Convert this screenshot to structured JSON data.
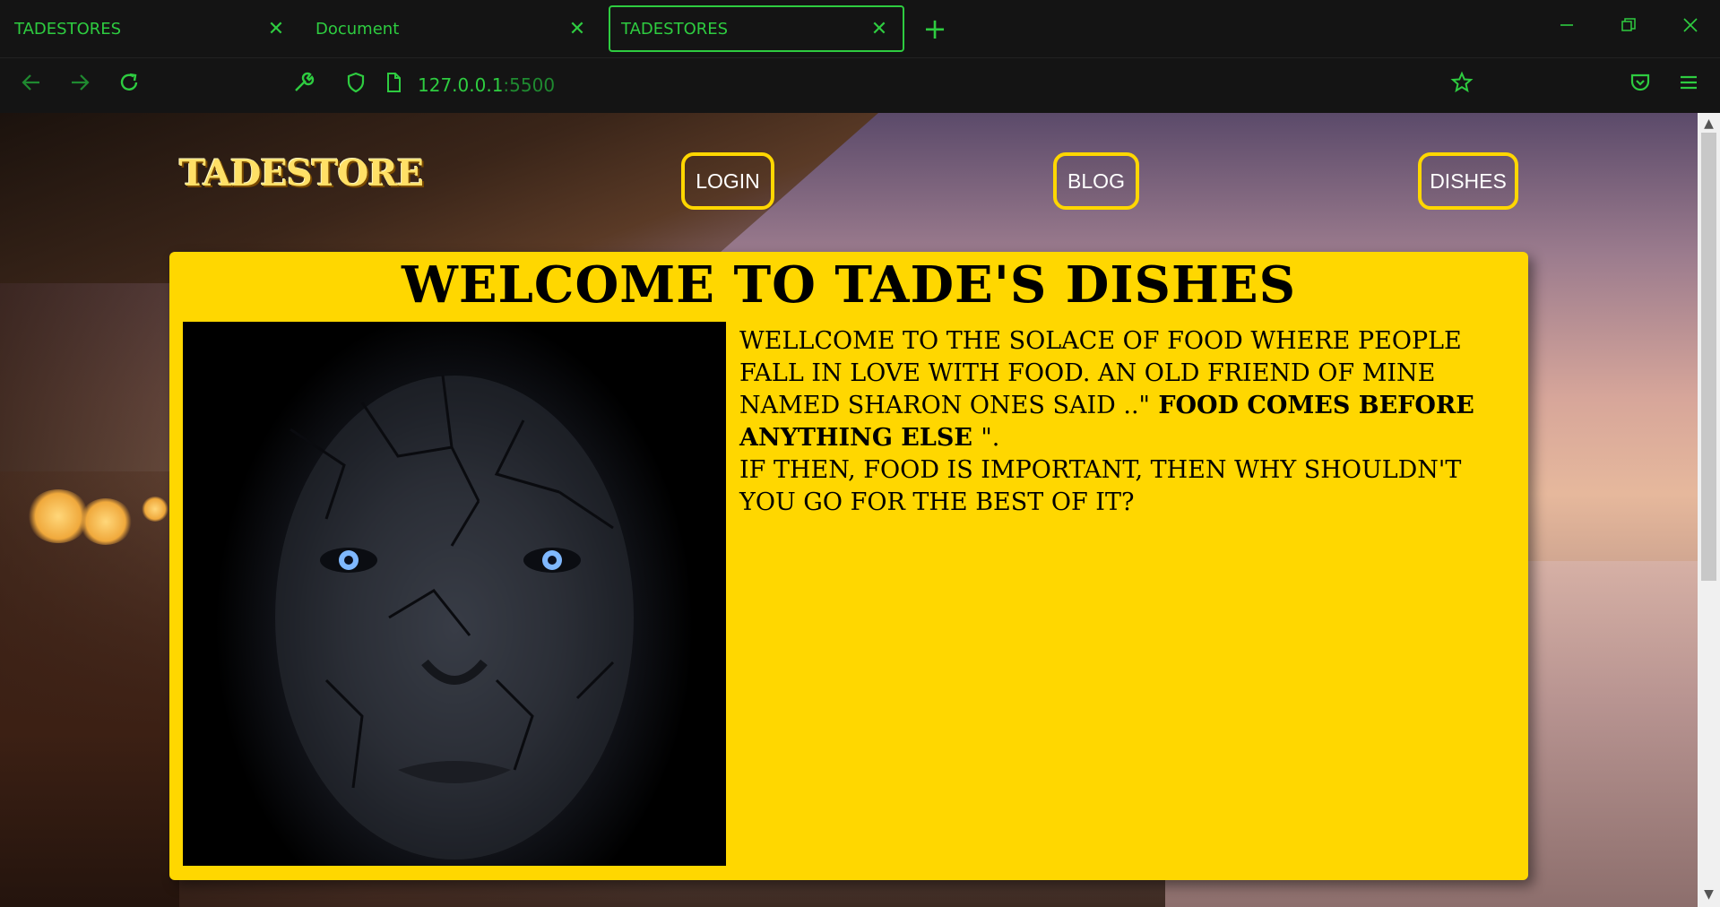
{
  "browser": {
    "tabs": [
      {
        "title": "TADESTORES",
        "active": false
      },
      {
        "title": "Document",
        "active": false
      },
      {
        "title": "TADESTORES",
        "active": true
      }
    ],
    "close_glyph": "✕",
    "new_tab_glyph": "+",
    "url_host": "127.0.0.1",
    "url_port": ":5500",
    "icons": [
      "back-arrow-icon",
      "forward-arrow-icon",
      "reload-icon",
      "wrench-icon",
      "shield-icon",
      "page-icon",
      "bookmark-star-icon",
      "pocket-icon",
      "hamburger-menu-icon",
      "minimize-icon",
      "restore-icon",
      "close-window-icon"
    ],
    "accent_color": "#2ecc40"
  },
  "site": {
    "logo": "TADESTORE",
    "nav": {
      "login": "LOGIN",
      "blog": "BLOG",
      "dishes": "DISHES"
    },
    "card": {
      "title": "WELCOME TO TADE'S DISHES",
      "text_part1": "WELLCOME TO THE SOLACE OF FOOD WHERE PEOPLE FALL IN LOVE WITH FOOD. AN OLD FRIEND OF MINE NAMED SHARON ONES SAID ..\"",
      "text_bold": " FOOD COMES BEFORE ANYTHING ELSE ",
      "text_part2": "\".",
      "text_part3": "IF THEN, FOOD IS IMPORTANT, THEN WHY SHOULDN'T YOU GO FOR THE BEST OF IT?"
    },
    "card_color": "#ffd700"
  }
}
